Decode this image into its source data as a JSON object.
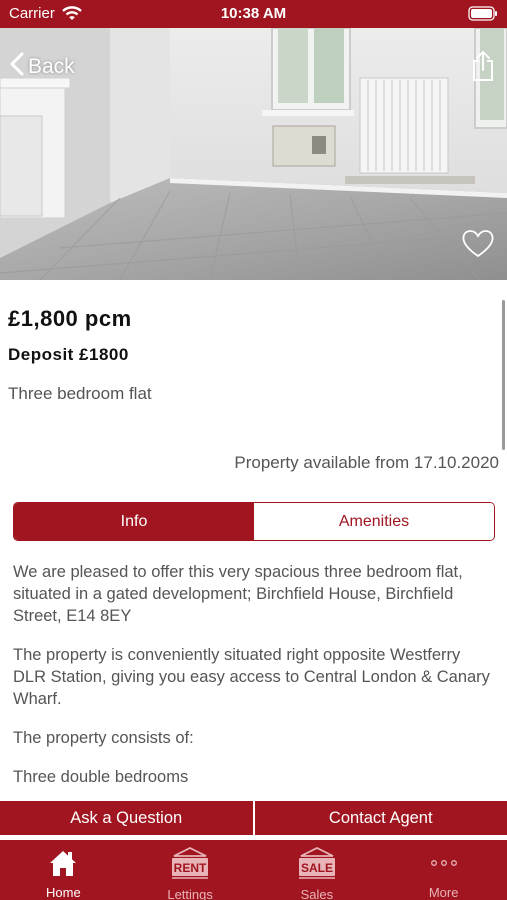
{
  "status_bar": {
    "carrier": "Carrier",
    "time": "10:38 AM"
  },
  "nav": {
    "back_label": "Back"
  },
  "property": {
    "price": "£1,800 pcm",
    "deposit": "Deposit £1800",
    "type": "Three bedroom flat",
    "availability": "Property available from 17.10.2020"
  },
  "segments": {
    "info": "Info",
    "amenities": "Amenities",
    "selected": "Info"
  },
  "description": {
    "paragraphs": [
      "We are pleased to offer this very spacious three bedroom flat, situated in a gated development; Birchfield House, Birchfield Street, E14 8EY",
      "The property is conveniently situated right opposite Westferry DLR Station, giving you easy access to Central London & Canary Wharf.",
      "The property consists of:",
      "Three double bedrooms"
    ]
  },
  "actions": {
    "ask": "Ask a Question",
    "contact": "Contact Agent"
  },
  "tabbar": {
    "items": [
      {
        "label": "Home",
        "icon": "home-icon",
        "active": true
      },
      {
        "label": "Lettings",
        "icon": "rent-sign-icon",
        "sign_text": "RENT",
        "active": false
      },
      {
        "label": "Sales",
        "icon": "sale-sign-icon",
        "sign_text": "SALE",
        "active": false
      },
      {
        "label": "More",
        "icon": "more-icon",
        "active": false
      }
    ]
  },
  "colors": {
    "brand": "#a0151f",
    "text": "#555555",
    "price": "#111111"
  }
}
